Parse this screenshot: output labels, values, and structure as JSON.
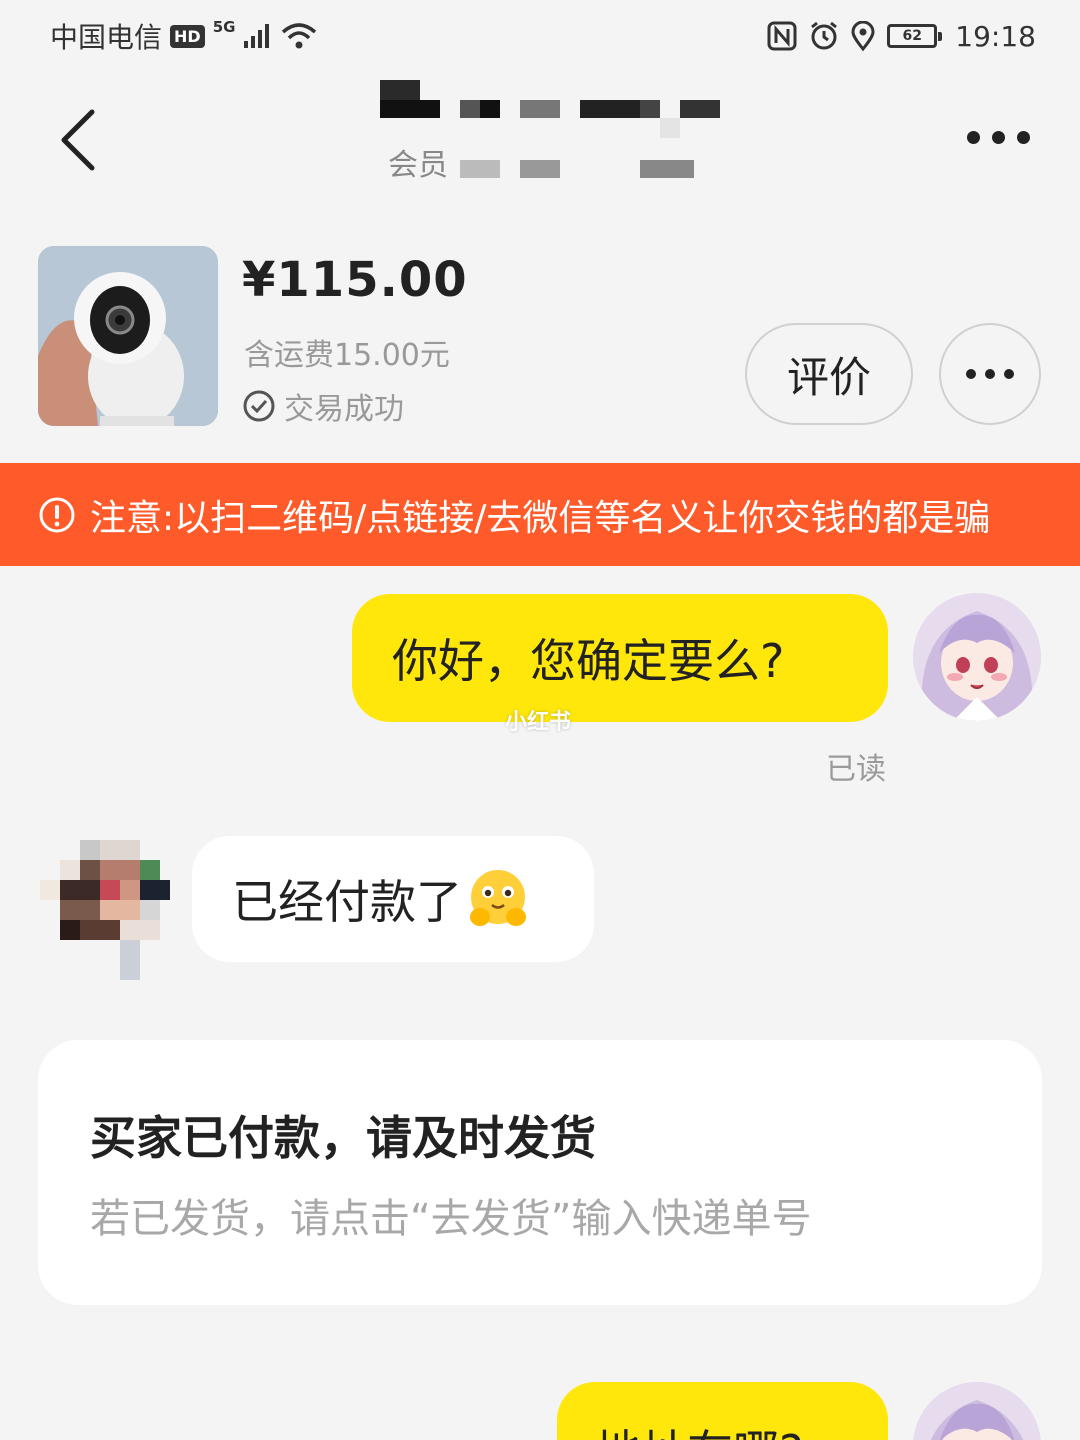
{
  "status_bar": {
    "carrier": "中国电信",
    "hd": "HD",
    "network": "5G",
    "nfc": "N",
    "battery": "62",
    "time": "19:18"
  },
  "header": {
    "member_label": "会员"
  },
  "product": {
    "price": "¥115.00",
    "shipping": "含运费15.00元",
    "status": "交易成功",
    "rate_button": "评价"
  },
  "warning": {
    "text": "注意:以扫二维码/点链接/去微信等名义让你交钱的都是骗"
  },
  "messages": [
    {
      "side": "me",
      "text": "你好，您确定要么?",
      "read": "已读"
    },
    {
      "side": "other",
      "text": "已经付款了"
    },
    {
      "side": "me",
      "text": "地址在哪?"
    }
  ],
  "watermark": "小红书",
  "notice_card": {
    "title": "买家已付款，请及时发货",
    "subtitle": "若已发货，请点击“去发货”输入快递单号"
  },
  "colors": {
    "accent_yellow": "#ffe70b",
    "warning_orange": "#ff5b2a",
    "background": "#f4f4f4"
  }
}
